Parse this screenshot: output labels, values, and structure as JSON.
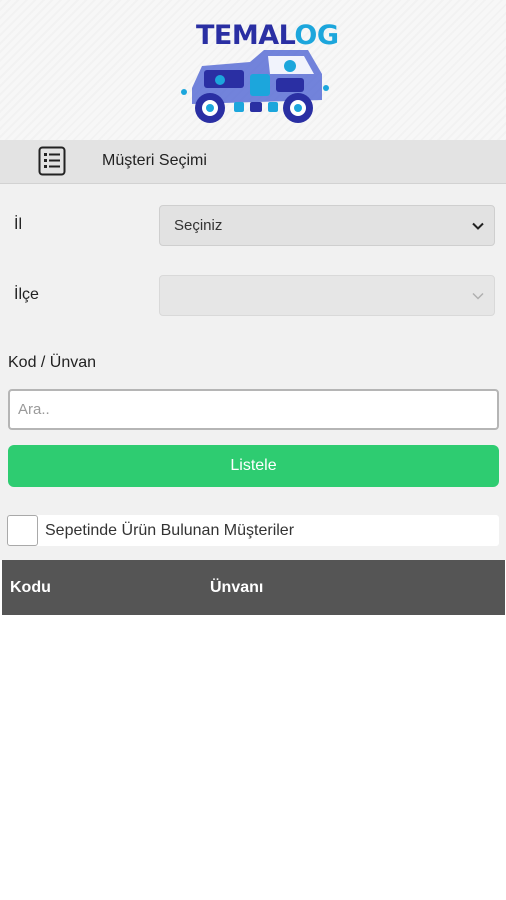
{
  "logo": {
    "text_part1": "TEMAL",
    "text_part2": "OG",
    "colors": {
      "primary": "#2a2fa3",
      "accent": "#1ca6dc"
    }
  },
  "title_bar": {
    "icon": "list-document-icon",
    "title": "Müşteri Seçimi"
  },
  "form": {
    "il": {
      "label": "İl",
      "selected": "Seçiniz"
    },
    "ilce": {
      "label": "İlçe",
      "selected": ""
    },
    "kod_unvan": {
      "label": "Kod / Ünvan",
      "placeholder": "Ara.."
    },
    "list_button": "Listele",
    "basket_filter": {
      "label": "Sepetinde Ürün Bulunan Müşteriler",
      "checked": false
    }
  },
  "table": {
    "columns": [
      "Kodu",
      "Ünvanı"
    ],
    "rows": []
  },
  "colors": {
    "button_green": "#2ecc71",
    "table_header": "#555555",
    "title_bar": "#e3e3e3"
  }
}
